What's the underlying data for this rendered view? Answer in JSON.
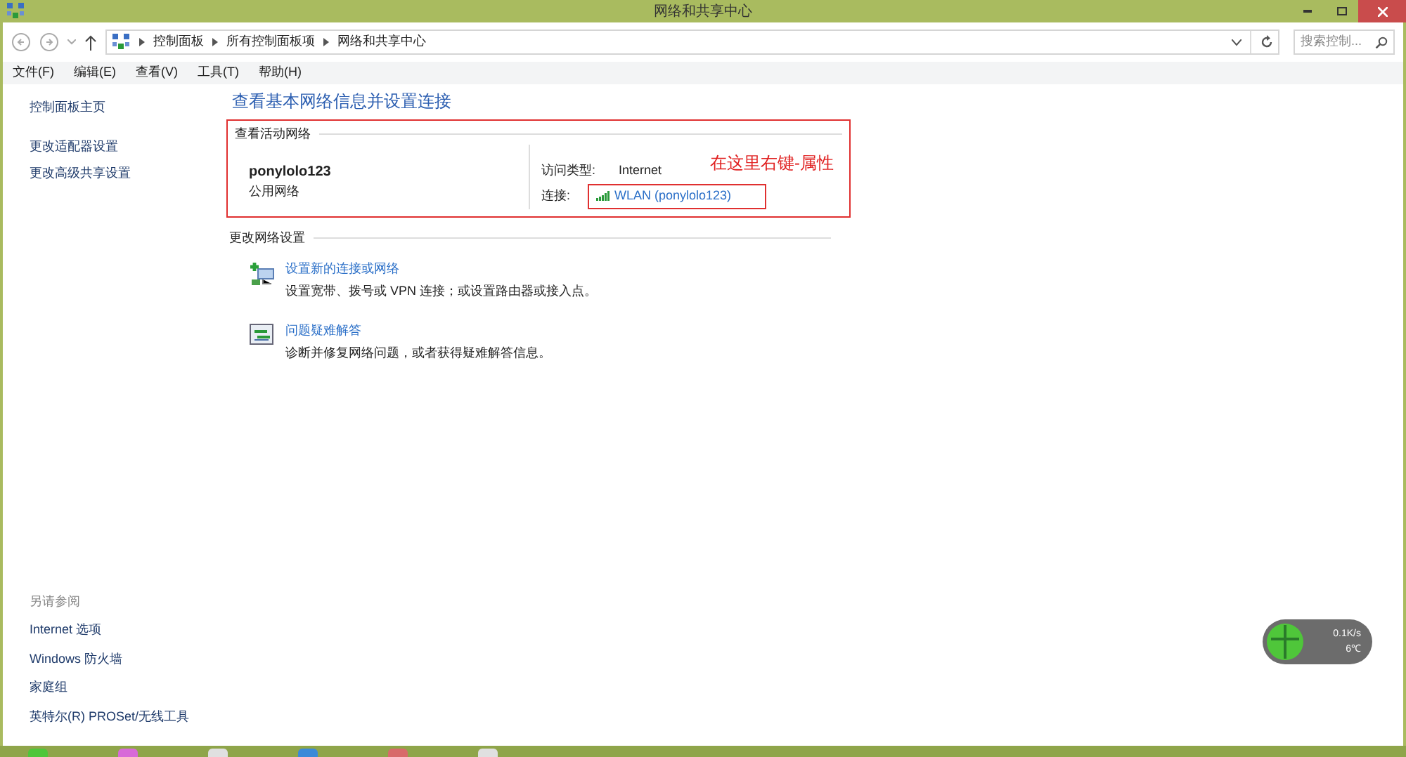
{
  "window": {
    "title": "网络和共享中心"
  },
  "address_bar": {
    "crumbs": [
      "控制面板",
      "所有控制面板项",
      "网络和共享中心"
    ],
    "search_placeholder": "搜索控制..."
  },
  "menu": [
    "文件(F)",
    "编辑(E)",
    "查看(V)",
    "工具(T)",
    "帮助(H)"
  ],
  "sidebar": {
    "items": [
      "控制面板主页",
      "更改适配器设置",
      "更改高级共享设置"
    ],
    "see_also_title": "另请参阅",
    "see_also": [
      "Internet 选项",
      "Windows 防火墙",
      "家庭组",
      "英特尔(R) PROSet/无线工具"
    ]
  },
  "main": {
    "heading": "查看基本网络信息并设置连接",
    "active_networks": {
      "title": "查看活动网络",
      "network_name": "ponylolo123",
      "network_type": "公用网络",
      "access_label": "访问类型:",
      "access_value": "Internet",
      "connection_label": "连接:",
      "connection_value": "WLAN (ponylolo123)",
      "annotation": "在这里右键-属性"
    },
    "change_settings": {
      "title": "更改网络设置",
      "items": [
        {
          "kind": "new-connection",
          "link": "设置新的连接或网络",
          "description": "设置宽带、拨号或 VPN 连接；或设置路由器或接入点。"
        },
        {
          "kind": "troubleshoot",
          "link": "问题疑难解答",
          "description": "诊断并修复网络问题，或者获得疑难解答信息。"
        }
      ]
    }
  },
  "speed_widget": {
    "speed": "0.1K/s",
    "temperature": "6℃"
  }
}
